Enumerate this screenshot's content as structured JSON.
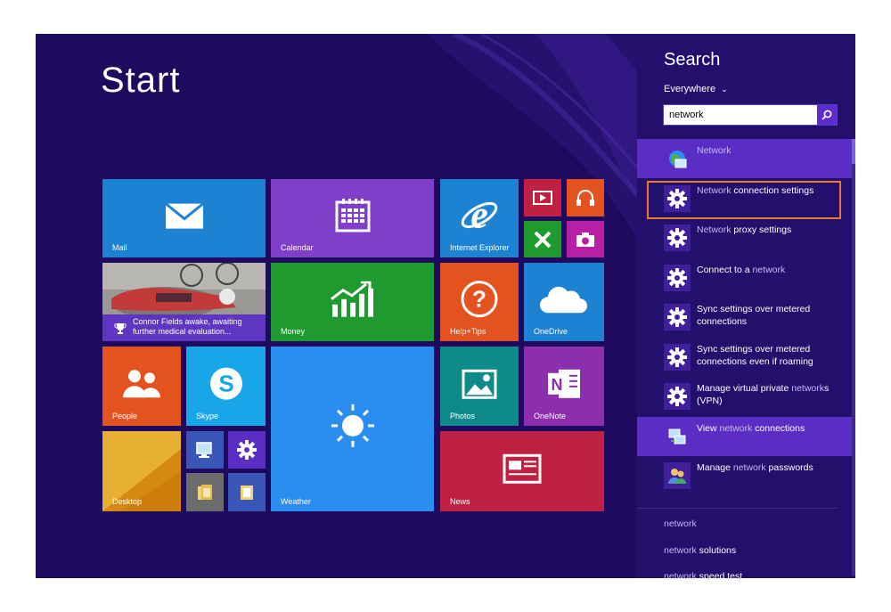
{
  "start": {
    "title": "Start"
  },
  "tiles": {
    "mail": "Mail",
    "calendar": "Calendar",
    "internet_explorer": "Internet Explorer",
    "news_feed": "Connor Fields awake, awaiting further medical evaluation...",
    "money": "Money",
    "help_tips": "Help+Tips",
    "onedrive": "OneDrive",
    "people": "People",
    "skype": "Skype",
    "weather": "Weather",
    "photos": "Photos",
    "onenote": "OneNote",
    "desktop": "Desktop",
    "news": "News"
  },
  "search": {
    "title": "Search",
    "scope": "Everywhere",
    "query": "network"
  },
  "results": [
    {
      "pre": "",
      "hl": "Network",
      "post": "",
      "icon": "network-globe-icon",
      "active": true
    },
    {
      "pre": "",
      "hl": "Network",
      "post": " connection settings",
      "icon": "settings-gear-icon",
      "active": false
    },
    {
      "pre": "",
      "hl": "Network",
      "post": " proxy settings",
      "icon": "settings-gear-icon",
      "active": false
    },
    {
      "pre": "Connect to a ",
      "hl": "network",
      "post": "",
      "icon": "settings-gear-icon",
      "active": false
    },
    {
      "pre": "Sync settings over metered connections",
      "hl": "",
      "post": "",
      "icon": "settings-gear-icon",
      "active": false
    },
    {
      "pre": "Sync settings over metered connections even if roaming",
      "hl": "",
      "post": "",
      "icon": "settings-gear-icon",
      "active": false
    },
    {
      "pre": "Manage virtual private ",
      "hl": "network",
      "post": "s (VPN)",
      "icon": "settings-gear-icon",
      "active": false
    },
    {
      "pre": "View ",
      "hl": "network",
      "post": " connections",
      "icon": "network-connections-icon",
      "active": true
    },
    {
      "pre": "Manage ",
      "hl": "network",
      "post": " passwords",
      "icon": "credential-manager-icon",
      "active": false
    }
  ],
  "suggestions": [
    {
      "hl": "network",
      "post": ""
    },
    {
      "hl": "network",
      "post": " solutions"
    },
    {
      "hl": "network",
      "post": " speed test"
    }
  ],
  "colors": {
    "background": "#1e0a5e",
    "panel": "#230f6c",
    "focus_outline": "#e87a2a",
    "mail": "#1d82d2",
    "calendar": "#7f3fc9",
    "money": "#1e9a2f",
    "help": "#e4521f",
    "weather": "#2b8df0",
    "news": "#c02042"
  }
}
